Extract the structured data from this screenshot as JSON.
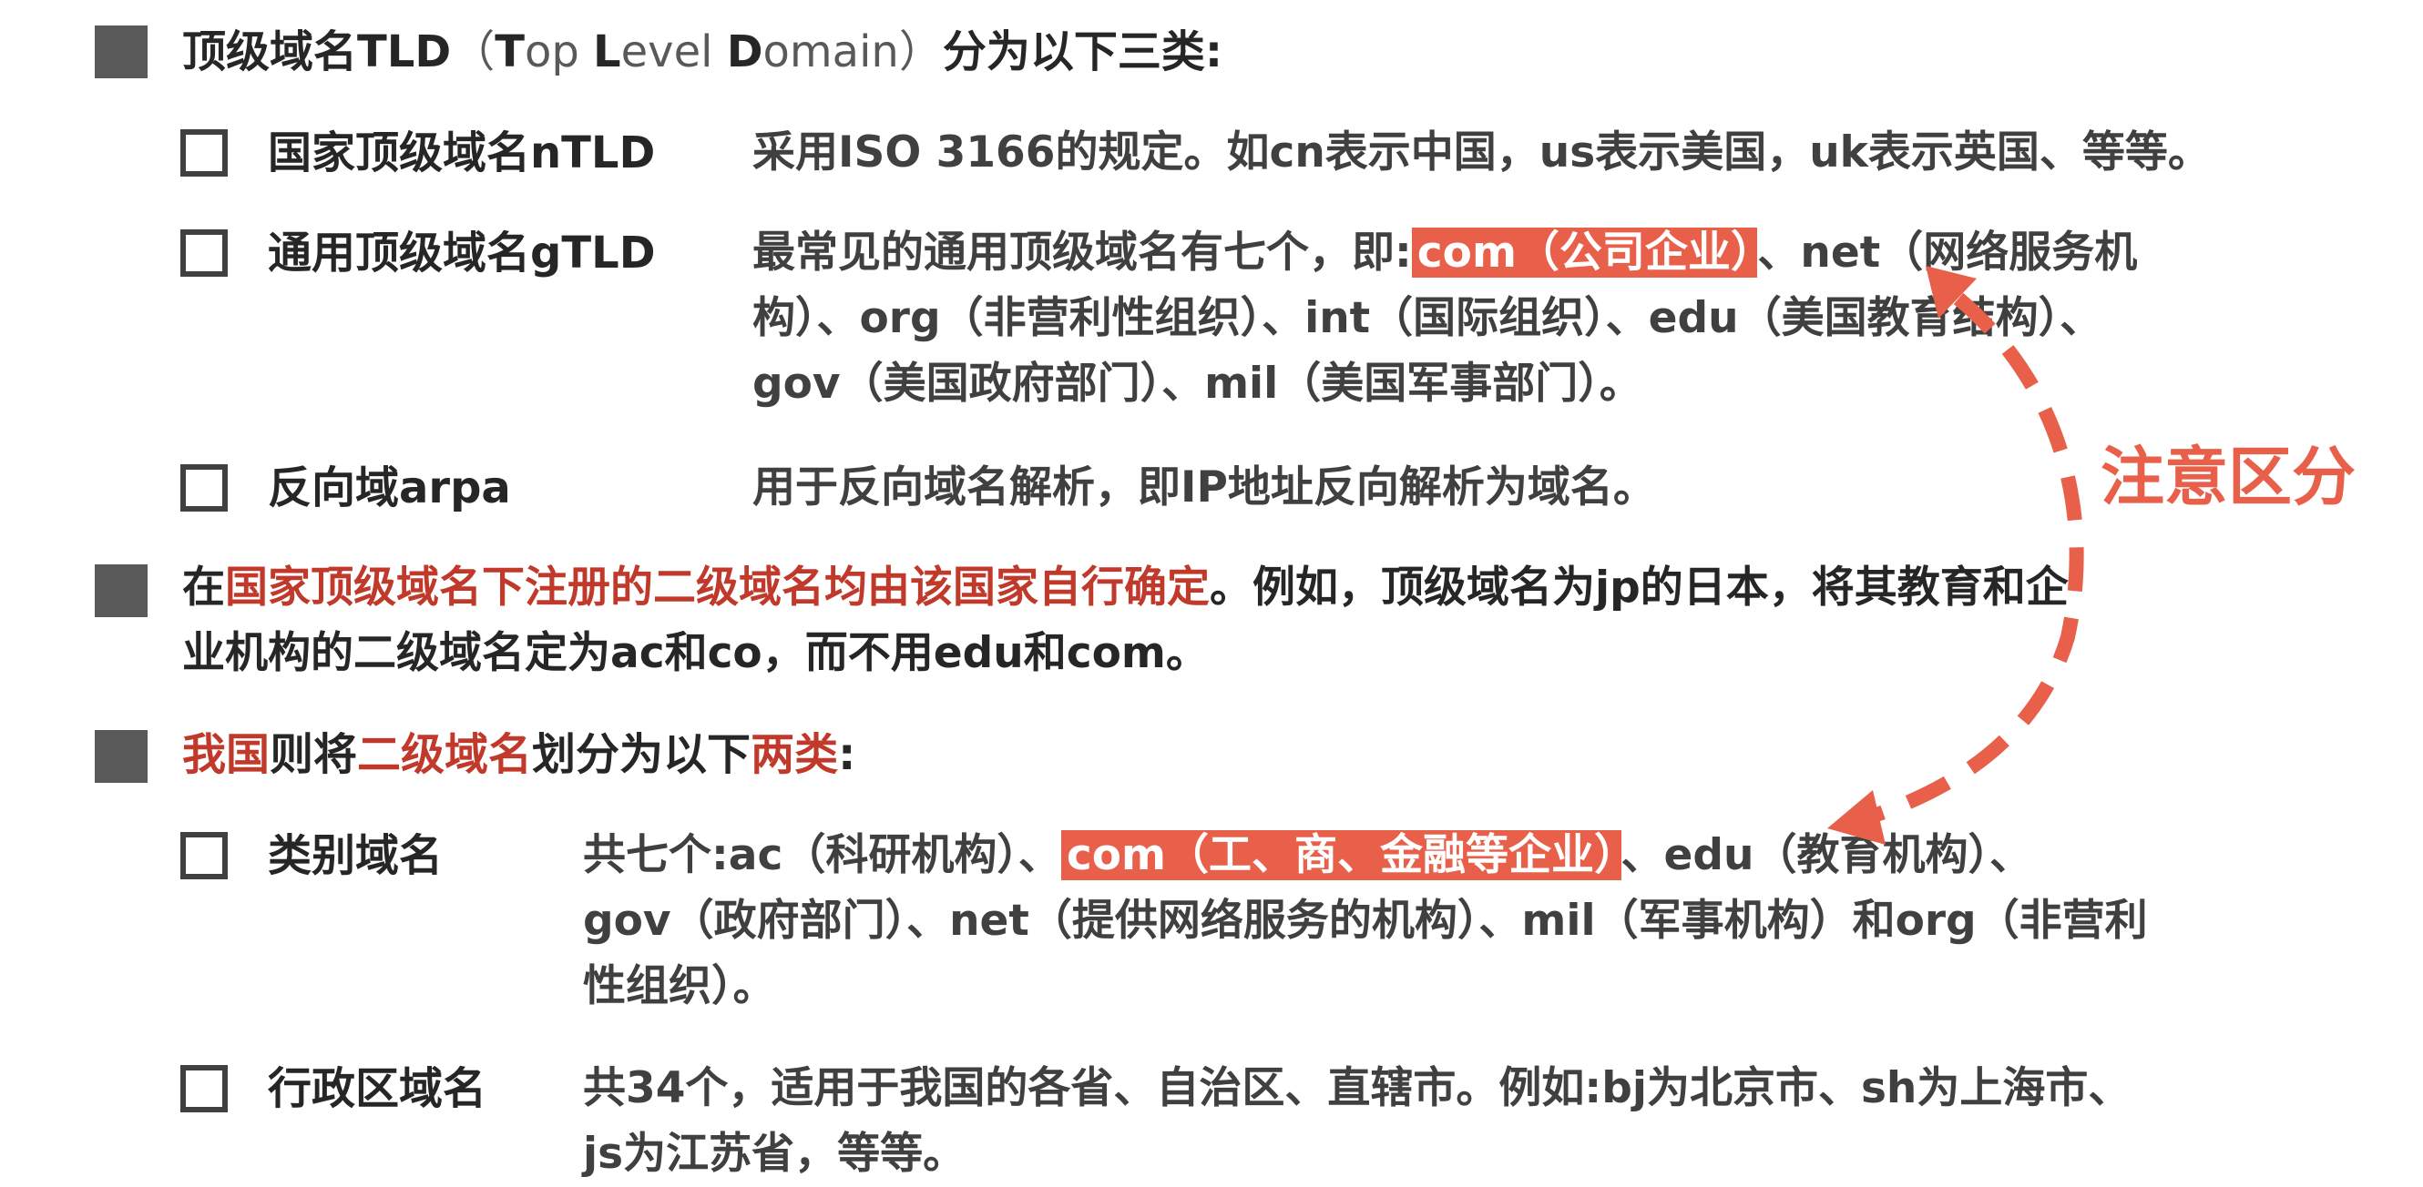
{
  "colors": {
    "accent": "#e8604a",
    "red_text": "#c0392b",
    "bullet": "#595959"
  },
  "tld_heading": {
    "prefix": "顶级域名TLD",
    "paren_open": "（",
    "en_T": "T",
    "en_op": "op ",
    "en_L": "L",
    "en_evel": "evel ",
    "en_D": "D",
    "en_omain": "omain",
    "paren_close": "）",
    "suffix": "分为以下三类:"
  },
  "ntld": {
    "label": "国家顶级域名nTLD",
    "desc": "采用ISO 3166的规定。如cn表示中国，us表示美国，uk表示英国、等等。"
  },
  "gtld": {
    "label": "通用顶级域名gTLD",
    "line1_before": "最常见的通用顶级域名有七个，即:",
    "line1_highlight": "com（公司企业）",
    "line1_after": "、net（网络服务机",
    "line2": "构）、org（非营利性组织）、int（国际组织）、edu（美国教育结构）、",
    "line3": "gov（美国政府部门）、mil（美国军事部门）。"
  },
  "arpa": {
    "label": "反向域arpa",
    "desc": "用于反向域名解析，即IP地址反向解析为域名。"
  },
  "note_callout": "注意区分",
  "country_note": {
    "line1_before": "在",
    "line1_red": "国家顶级域名下注册的二级域名均由该国家自行确定",
    "line1_after": "。例如，顶级域名为jp的日本，将其教育和企",
    "line2": "业机构的二级域名定为ac和co，而不用edu和com。"
  },
  "china_heading": {
    "part1_red": "我国",
    "part2": "则将",
    "part3_red": "二级域名",
    "part4": "划分为以下",
    "part5_red": "两类",
    "part6": ":"
  },
  "category": {
    "label": "类别域名",
    "line1_before": "共七个:ac（科研机构）、",
    "line1_highlight": "com（工、商、金融等企业）",
    "line1_after": "、edu（教育机构）、",
    "line2": "gov（政府部门）、net（提供网络服务的机构）、mil（军事机构）和org（非营利",
    "line3": "性组织）。"
  },
  "admin": {
    "label": "行政区域名",
    "line1": "共34个，适用于我国的各省、自治区、直辖市。例如:bj为北京市、sh为上海市、",
    "line2": "js为江苏省，等等。"
  }
}
